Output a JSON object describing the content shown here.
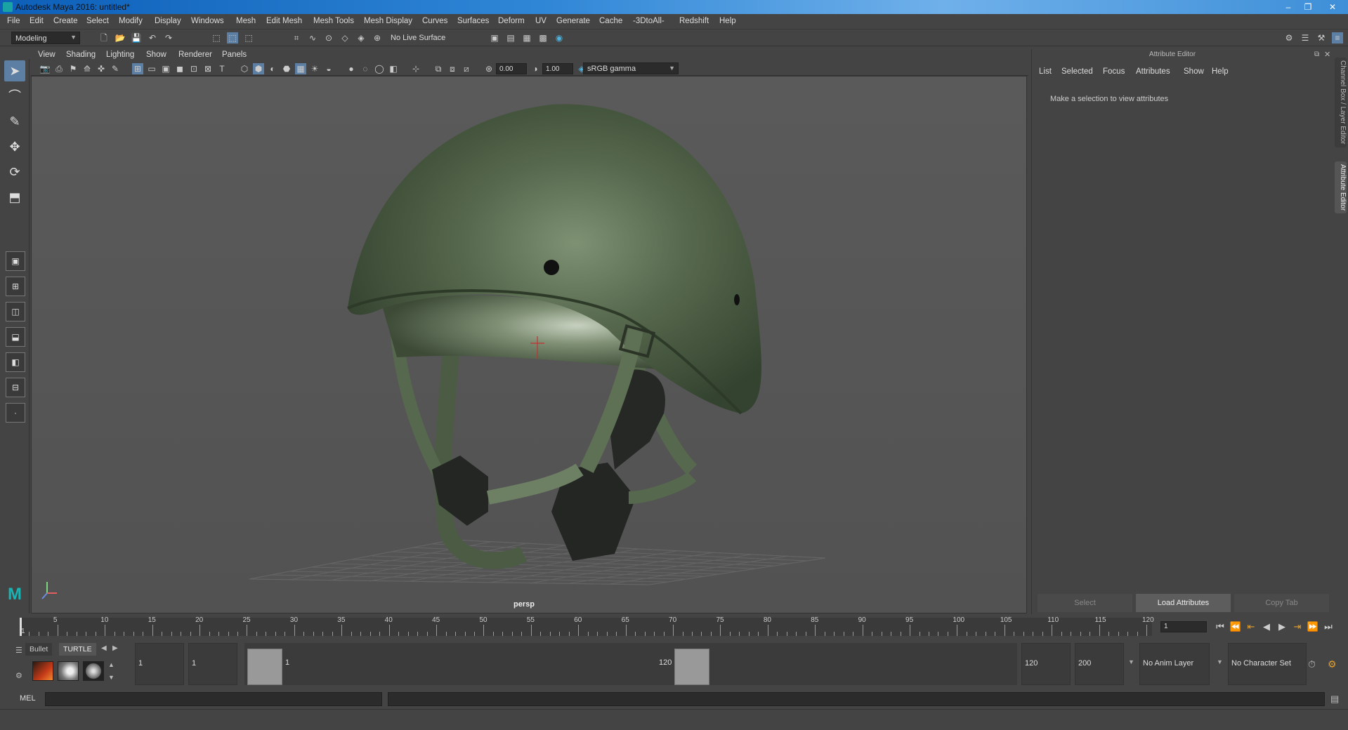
{
  "window": {
    "title": "Autodesk Maya 2016: untitled*",
    "minimize": "–",
    "maximize": "❐",
    "close": "✕"
  },
  "menubar": [
    "File",
    "Edit",
    "Create",
    "Select",
    "Modify",
    "Display",
    "Windows",
    "Mesh",
    "Edit Mesh",
    "Mesh Tools",
    "Mesh Display",
    "Curves",
    "Surfaces",
    "Deform",
    "UV",
    "Generate",
    "Cache",
    "-3DtoAll-",
    "Redshift",
    "Help"
  ],
  "shelf": {
    "menu_set": "Modeling",
    "live_surface": "No Live Surface"
  },
  "viewport": {
    "menu": [
      "View",
      "Shading",
      "Lighting",
      "Show",
      "Renderer",
      "Panels"
    ],
    "exposure": "0.00",
    "gamma": "1.00",
    "color_space": "sRGB gamma",
    "camera_label": "persp"
  },
  "attribute_editor": {
    "title": "Attribute Editor",
    "menu": [
      "List",
      "Selected",
      "Focus",
      "Attributes",
      "Show",
      "Help"
    ],
    "message": "Make a selection to view attributes",
    "buttons": [
      "Select",
      "Load Attributes",
      "Copy Tab"
    ]
  },
  "side_tabs": [
    "Channel Box / Layer Editor",
    "Attribute Editor"
  ],
  "timeline": {
    "ticks": [
      "1",
      "5",
      "10",
      "15",
      "20",
      "25",
      "30",
      "35",
      "40",
      "45",
      "50",
      "55",
      "60",
      "65",
      "70",
      "75",
      "80",
      "85",
      "90",
      "95",
      "100",
      "105",
      "110",
      "115",
      "120"
    ],
    "current_frame": "1"
  },
  "range": {
    "shelf_tabs": [
      "Bullet",
      "TURTLE"
    ],
    "start_time": "1",
    "playback_start": "1",
    "slider_start": "1",
    "slider_end": "120",
    "playback_end": "120",
    "end_time": "200",
    "anim_layer": "No Anim Layer",
    "character_set": "No Character Set"
  },
  "cmdline": {
    "label": "MEL"
  }
}
